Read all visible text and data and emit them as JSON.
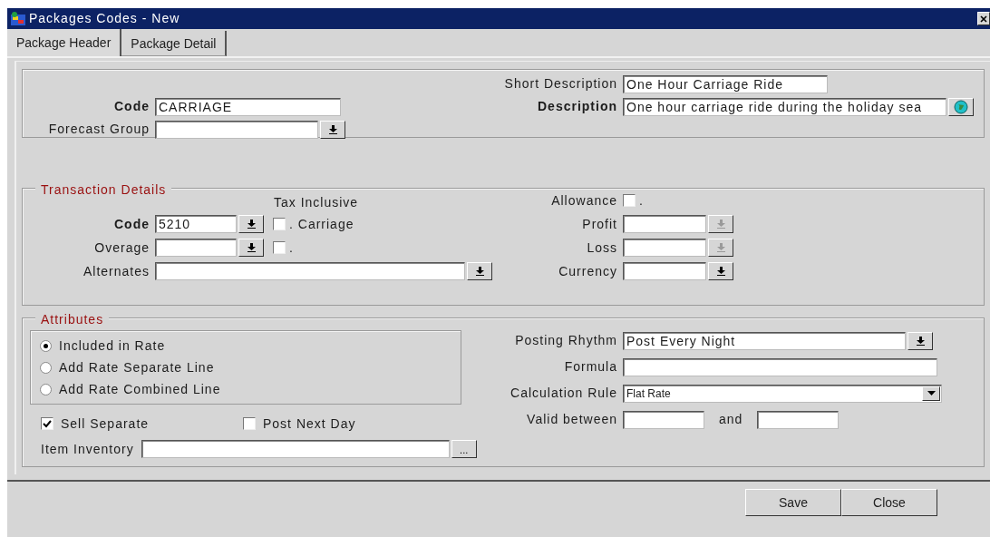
{
  "window": {
    "title": "Packages Codes - New"
  },
  "tabs": [
    {
      "label": "Package Header",
      "selected": true
    },
    {
      "label": "Package Detail",
      "selected": false
    }
  ],
  "header": {
    "left": [
      {
        "label": "Code",
        "bold": true,
        "kind": "text",
        "value": "CARRIAGE"
      },
      {
        "label": "Forecast Group",
        "bold": false,
        "kind": "dropdown"
      }
    ],
    "right": [
      {
        "label": "Short Description",
        "bold": false,
        "kind": "text",
        "value": "One Hour Carriage Ride"
      },
      {
        "label": "Description",
        "bold": true,
        "kind": "lookup",
        "value": "One hour carriage ride during the holiday sea"
      }
    ]
  },
  "transaction": {
    "title": "Transaction Details",
    "tax_header": "Tax Inclusive",
    "left": [
      {
        "label": "Code",
        "bold": true,
        "kind": "dropdown",
        "value": "5210",
        "tax_inclusive": {
          "checked": false,
          "text": ". Carriage"
        }
      },
      {
        "label": "Overage",
        "bold": false,
        "kind": "dropdown",
        "tax_inclusive": {
          "checked": false,
          "text": "."
        }
      },
      {
        "label": "Alternates",
        "bold": false,
        "kind": "dropdown"
      }
    ],
    "right": [
      {
        "label": "Allowance",
        "bold": false,
        "kind": "checkbox",
        "checked": false,
        "text": "."
      },
      {
        "label": "Profit",
        "bold": false,
        "kind": "dropdown",
        "disabled": true
      },
      {
        "label": "Loss",
        "bold": false,
        "kind": "dropdown",
        "disabled": true
      },
      {
        "label": "Currency",
        "bold": false,
        "kind": "dropdown",
        "disabled": false
      }
    ]
  },
  "attributes": {
    "title": "Attributes",
    "radios": [
      {
        "label": "Included in Rate",
        "selected": true
      },
      {
        "label": "Add Rate Separate Line",
        "selected": false
      },
      {
        "label": "Add Rate Combined Line",
        "selected": false
      }
    ],
    "checks": [
      {
        "label": "Sell Separate",
        "checked": true
      },
      {
        "label": "Post Next Day",
        "checked": false
      }
    ],
    "inventory": {
      "label": "Item Inventory",
      "kind": "ellipsis",
      "button": "..."
    },
    "right": [
      {
        "label": "Posting Rhythm",
        "bold": false,
        "kind": "dropdown",
        "value": "Post Every Night"
      },
      {
        "label": "Formula",
        "bold": false,
        "kind": "text"
      },
      {
        "label": "Calculation Rule",
        "bold": false,
        "kind": "combo",
        "value": "Flat Rate"
      },
      {
        "label": "Valid between",
        "bold": false,
        "kind": "range",
        "joiner": "and"
      }
    ]
  },
  "buttons": [
    "Save",
    "Close"
  ]
}
